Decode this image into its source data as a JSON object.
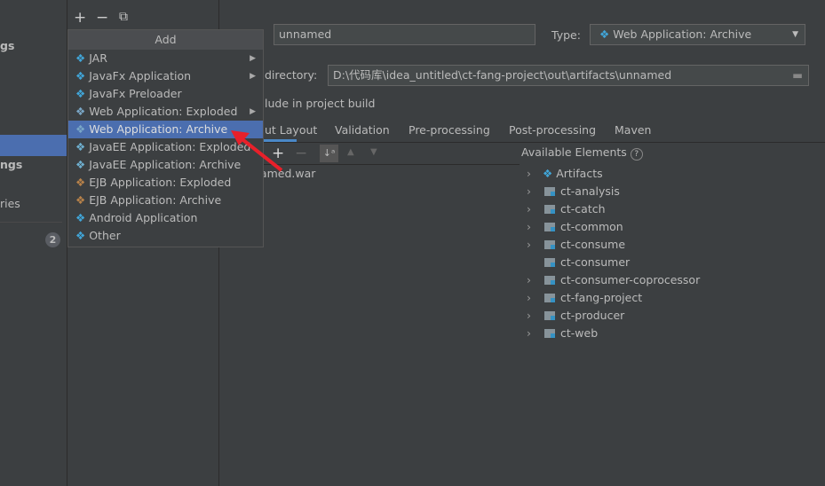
{
  "sidebar": {
    "items": [
      "gs",
      "",
      "ngs",
      "ries"
    ],
    "badge": "2"
  },
  "toolbar": {
    "add": "+",
    "remove": "−",
    "copy": "⧉"
  },
  "popup": {
    "title": "Add",
    "items": [
      {
        "label": "JAR",
        "submenu": true,
        "icon": "artifact-icon"
      },
      {
        "label": "JavaFx Application",
        "submenu": true,
        "icon": "artifact-icon"
      },
      {
        "label": "JavaFx Preloader",
        "submenu": false,
        "icon": "artifact-icon"
      },
      {
        "label": "Web Application: Exploded",
        "submenu": true,
        "icon": "web-icon"
      },
      {
        "label": "Web Application: Archive",
        "submenu": false,
        "icon": "web-icon",
        "selected": true
      },
      {
        "label": "JavaEE Application: Exploded",
        "submenu": false,
        "icon": "javaee-icon"
      },
      {
        "label": "JavaEE Application: Archive",
        "submenu": false,
        "icon": "javaee-icon"
      },
      {
        "label": "EJB Application: Exploded",
        "submenu": false,
        "icon": "ejb-icon"
      },
      {
        "label": "EJB Application: Archive",
        "submenu": false,
        "icon": "ejb-icon"
      },
      {
        "label": "Android Application",
        "submenu": false,
        "icon": "artifact-icon"
      },
      {
        "label": "Other",
        "submenu": false,
        "icon": "artifact-icon"
      }
    ]
  },
  "form": {
    "name_value": "unnamed",
    "type_label": "Type:",
    "type_value": "Web Application: Archive",
    "dir_label": "directory:",
    "dir_value": "D:\\代码库\\idea_untitled\\ct-fang-project\\out\\artifacts\\unnamed",
    "include_label": "lude in project build"
  },
  "tabs": [
    "ut Layout",
    "Validation",
    "Pre-processing",
    "Post-processing",
    "Maven"
  ],
  "layout": {
    "root_item": "named.war"
  },
  "available": {
    "title": "Available Elements",
    "items": [
      {
        "label": "Artifacts",
        "expandable": true,
        "icon": "artifact-icon"
      },
      {
        "label": "ct-analysis",
        "expandable": true,
        "icon": "module-folder-icon"
      },
      {
        "label": "ct-catch",
        "expandable": true,
        "icon": "module-folder-icon"
      },
      {
        "label": "ct-common",
        "expandable": true,
        "icon": "module-folder-icon"
      },
      {
        "label": "ct-consume",
        "expandable": true,
        "icon": "module-folder-icon"
      },
      {
        "label": "ct-consumer",
        "expandable": false,
        "icon": "module-folder-icon"
      },
      {
        "label": "ct-consumer-coprocessor",
        "expandable": true,
        "icon": "module-folder-icon"
      },
      {
        "label": "ct-fang-project",
        "expandable": true,
        "icon": "module-folder-icon"
      },
      {
        "label": "ct-producer",
        "expandable": true,
        "icon": "module-folder-icon"
      },
      {
        "label": "ct-web",
        "expandable": true,
        "icon": "module-folder-icon"
      }
    ]
  },
  "colors": {
    "selection": "#4b6eaf",
    "background": "#3c3f41",
    "annotation_arrow": "#e8202a"
  }
}
